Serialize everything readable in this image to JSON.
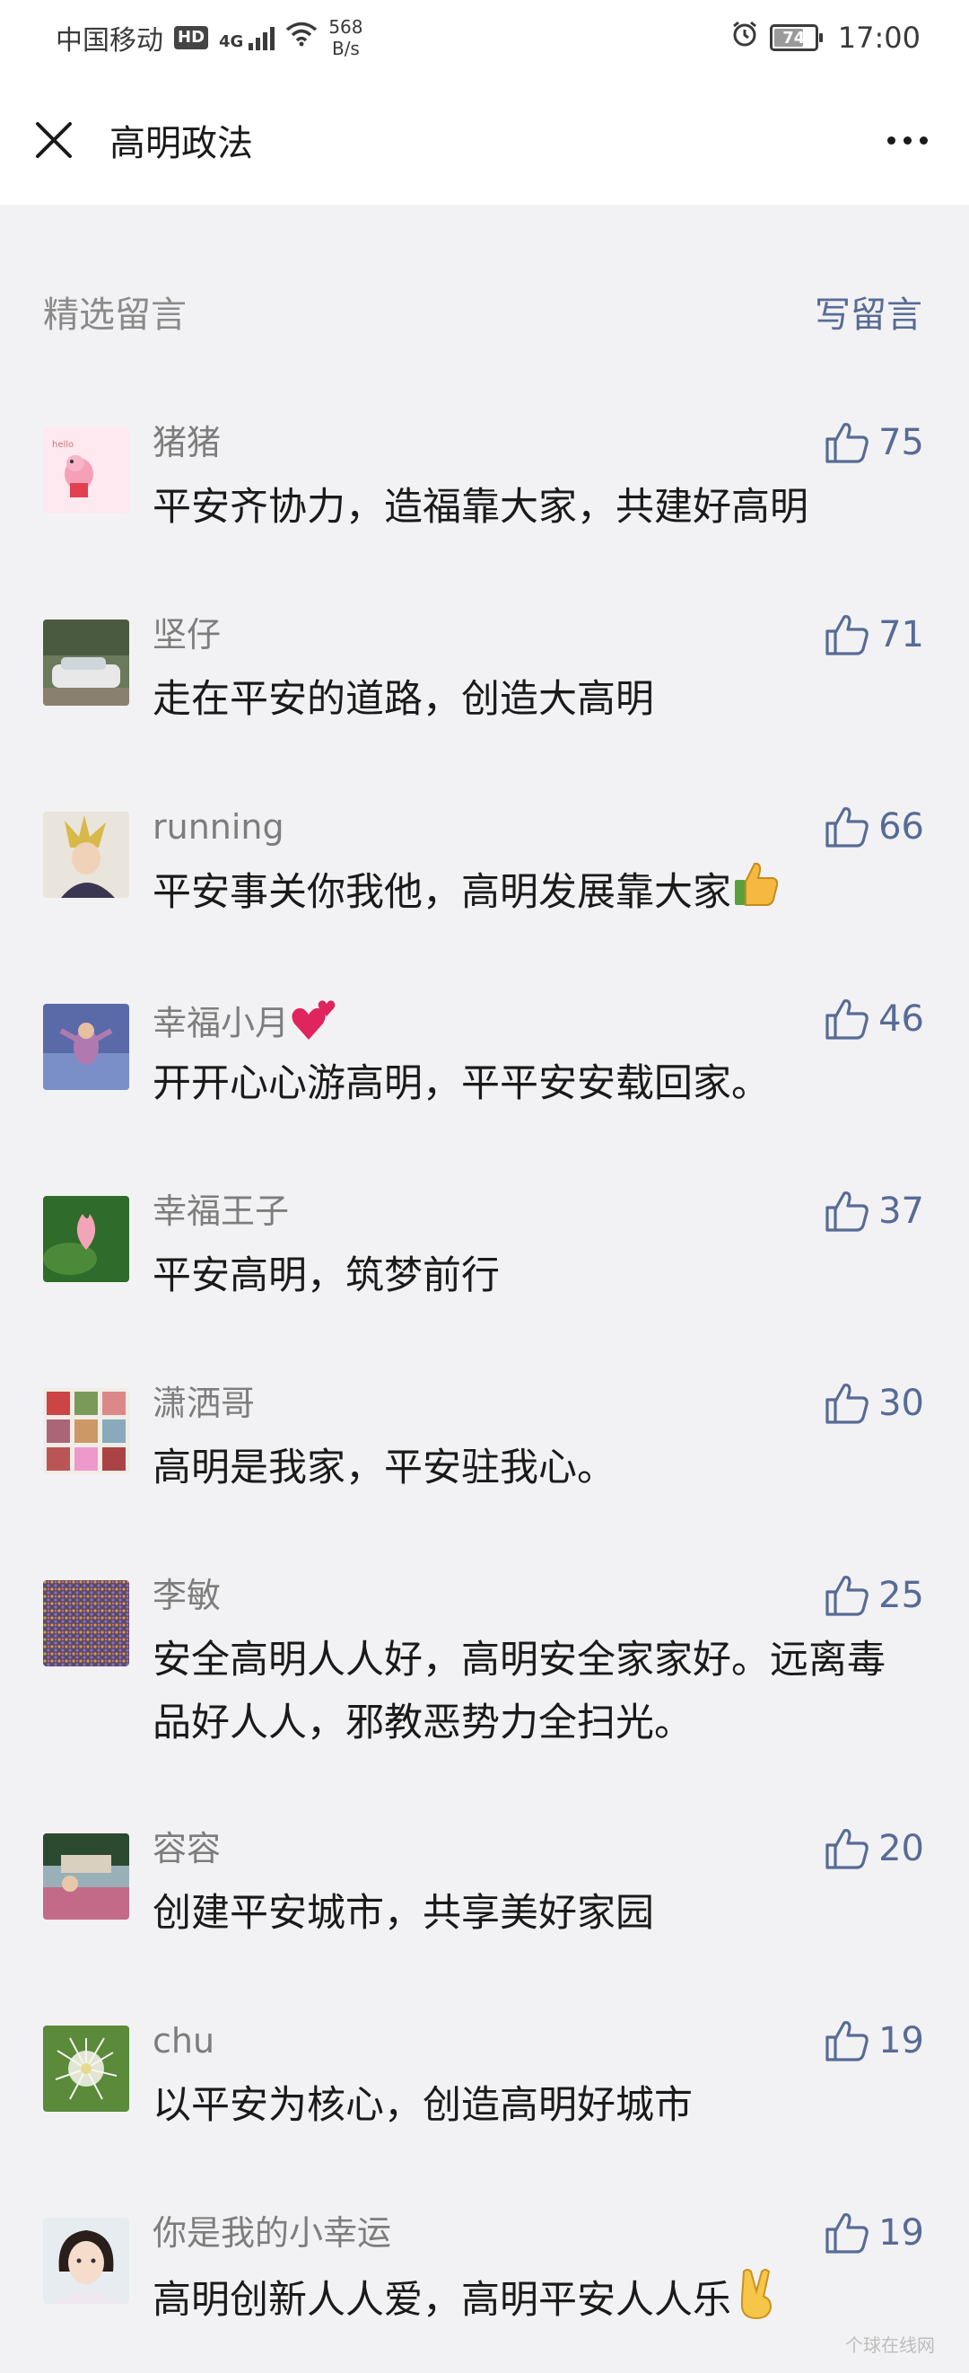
{
  "status_bar": {
    "carrier": "中国移动",
    "hd": "HD",
    "network": "4G",
    "speed_value": "568",
    "speed_unit": "B/s",
    "battery": "74",
    "battery_level": 0.74,
    "time": "17:00"
  },
  "header": {
    "title": "高明政法"
  },
  "section": {
    "title": "精选留言",
    "write_label": "写留言"
  },
  "comments": [
    {
      "name": "猪猪",
      "text": "平安齐协力，造福靠大家，共建好高明",
      "likes": "75"
    },
    {
      "name": "坚仔",
      "text": "走在平安的道路，创造大高明",
      "likes": "71"
    },
    {
      "name": "running",
      "text": "平安事关你我他，高明发展靠大家",
      "likes": "66"
    },
    {
      "name": "幸福小月",
      "text": "开开心心游高明，平平安安载回家。",
      "likes": "46"
    },
    {
      "name": "幸福王子",
      "text": "平安高明，筑梦前行",
      "likes": "37"
    },
    {
      "name": "潇洒哥",
      "text": "高明是我家，平安驻我心。",
      "likes": "30"
    },
    {
      "name": "李敏",
      "text": "安全高明人人好，高明安全家家好。远离毒品好人人，邪教恶势力全扫光。",
      "likes": "25"
    },
    {
      "name": "容容",
      "text": "创建平安城市，共享美好家园",
      "likes": "20"
    },
    {
      "name": "chu",
      "text": "以平安为核心，创造高明好城市",
      "likes": "19"
    },
    {
      "name": "你是我的小幸运",
      "text": "高明创新人人爱，高明平安人人乐",
      "likes": "19"
    }
  ],
  "watermark": "个球在线网",
  "colors": {
    "link": "#576b95",
    "name_gray": "#7d7d7d",
    "background": "#f2f2f4"
  }
}
